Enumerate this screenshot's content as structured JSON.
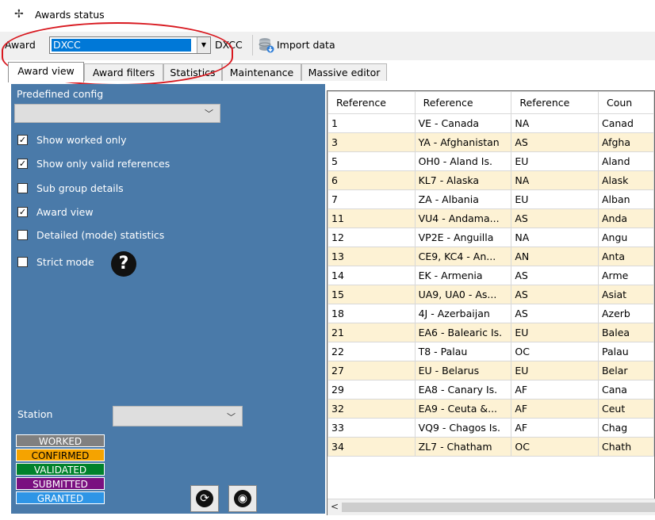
{
  "window": {
    "title": "Awards status"
  },
  "toolbar": {
    "award_label": "Award",
    "award_value": "DXCC",
    "award_code": "DXCC",
    "import_label": "Import data"
  },
  "tabs": [
    "Award view",
    "Award filters",
    "Statistics",
    "Maintenance",
    "Massive editor"
  ],
  "active_tab": "Award view",
  "left_panel": {
    "predefined_label": "Predefined config",
    "predefined_value": "",
    "options": [
      {
        "label": "Show worked only",
        "checked": true
      },
      {
        "label": "Show only valid references",
        "checked": true
      },
      {
        "label": "Sub group details",
        "checked": false
      },
      {
        "label": "Award view",
        "checked": true
      },
      {
        "label": "Detailed (mode) statistics",
        "checked": false
      },
      {
        "label": "Strict mode",
        "checked": false
      }
    ],
    "station_label": "Station",
    "station_value": "",
    "legend": [
      {
        "label": "WORKED",
        "bg": "#808080",
        "fg": "#ffffff"
      },
      {
        "label": "CONFIRMED",
        "bg": "#f5a300",
        "fg": "#000000"
      },
      {
        "label": "VALIDATED",
        "bg": "#00822c",
        "fg": "#ffffff"
      },
      {
        "label": "SUBMITTED",
        "bg": "#7a1080",
        "fg": "#ffffff"
      },
      {
        "label": "GRANTED",
        "bg": "#2e95e6",
        "fg": "#ffffff"
      }
    ]
  },
  "grid": {
    "columns": [
      "Reference",
      "Reference",
      "Reference",
      "Coun"
    ],
    "rows": [
      [
        "1",
        "VE - Canada",
        "NA",
        "Canad"
      ],
      [
        "3",
        "YA - Afghanistan",
        "AS",
        "Afgha"
      ],
      [
        "5",
        "OH0 - Aland Is.",
        "EU",
        "Aland"
      ],
      [
        "6",
        "KL7 - Alaska",
        "NA",
        "Alask"
      ],
      [
        "7",
        "ZA - Albania",
        "EU",
        "Alban"
      ],
      [
        "11",
        "VU4 - Andama...",
        "AS",
        "Anda"
      ],
      [
        "12",
        "VP2E - Anguilla",
        "NA",
        "Angu"
      ],
      [
        "13",
        "CE9, KC4 - An...",
        "AN",
        "Anta"
      ],
      [
        "14",
        "EK - Armenia",
        "AS",
        "Arme"
      ],
      [
        "15",
        "UA9, UA0 - As...",
        "AS",
        "Asiat"
      ],
      [
        "18",
        "4J - Azerbaijan",
        "AS",
        "Azerb"
      ],
      [
        "21",
        "EA6 - Balearic Is.",
        "EU",
        "Balea"
      ],
      [
        "22",
        "T8 - Palau",
        "OC",
        "Palau"
      ],
      [
        "27",
        "EU - Belarus",
        "EU",
        "Belar"
      ],
      [
        "29",
        "EA8 - Canary Is.",
        "AF",
        "Cana"
      ],
      [
        "32",
        "EA9 - Ceuta &...",
        "AF",
        "Ceut"
      ],
      [
        "33",
        "VQ9 - Chagos Is.",
        "AF",
        "Chag"
      ],
      [
        "34",
        "ZL7 - Chatham",
        "OC",
        "Chath"
      ]
    ]
  },
  "scrollbar": {
    "left_arrow": "<"
  }
}
